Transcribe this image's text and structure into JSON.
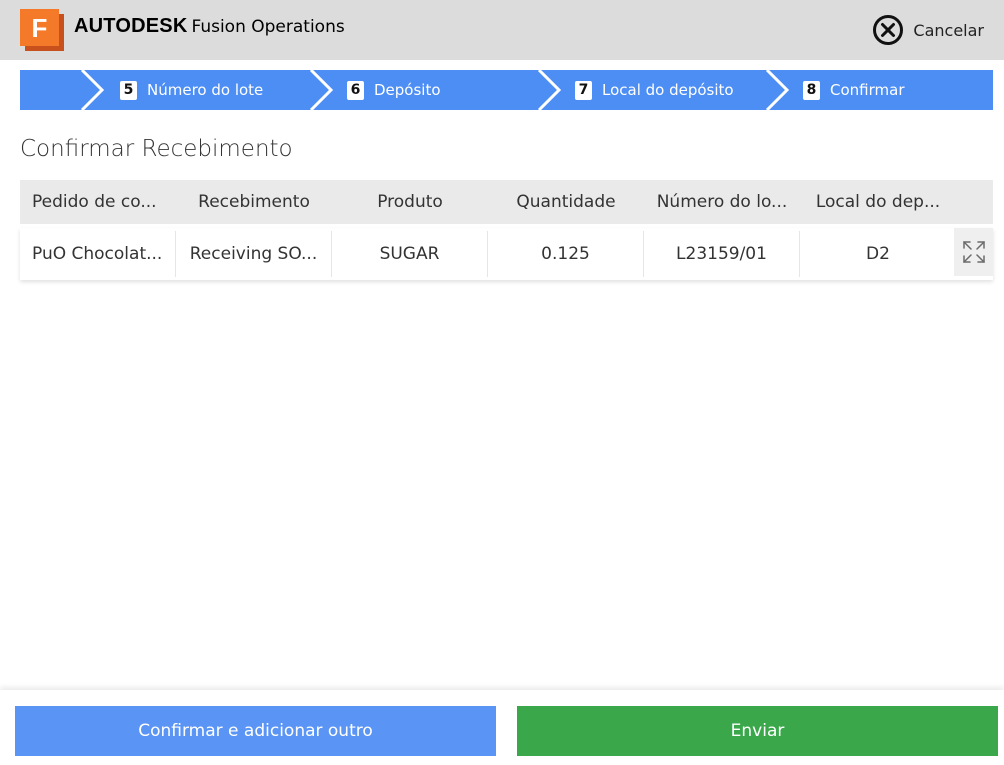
{
  "header": {
    "brand_bold": "AUTODESK",
    "brand_rest": "Fusion Operations",
    "logo_letter": "F",
    "cancel_label": "Cancelar"
  },
  "steps": [
    {
      "number": "5",
      "label": "Número do lote"
    },
    {
      "number": "6",
      "label": "Depósito"
    },
    {
      "number": "7",
      "label": "Local do depósito"
    },
    {
      "number": "8",
      "label": "Confirmar"
    }
  ],
  "page_title": "Confirmar Recebimento",
  "table": {
    "columns": [
      "Pedido de co...",
      "Recebimento",
      "Produto",
      "Quantidade",
      "Número do lo...",
      "Local do dep..."
    ],
    "rows": [
      [
        "PuO Chocolat...",
        "Receiving SO...",
        "SUGAR",
        "0.125",
        "L23159/01",
        "D2"
      ]
    ]
  },
  "footer": {
    "confirm_add_label": "Confirmar e adicionar outro",
    "submit_label": "Enviar"
  },
  "colors": {
    "step_blue": "#4d8ef5",
    "button_blue": "#5a94f5",
    "button_green": "#3aa84a",
    "logo_orange": "#f47a2a"
  },
  "icons": {
    "logo": "fusion-logo-icon",
    "cancel": "close-circle-icon",
    "expand": "expand-icon"
  }
}
